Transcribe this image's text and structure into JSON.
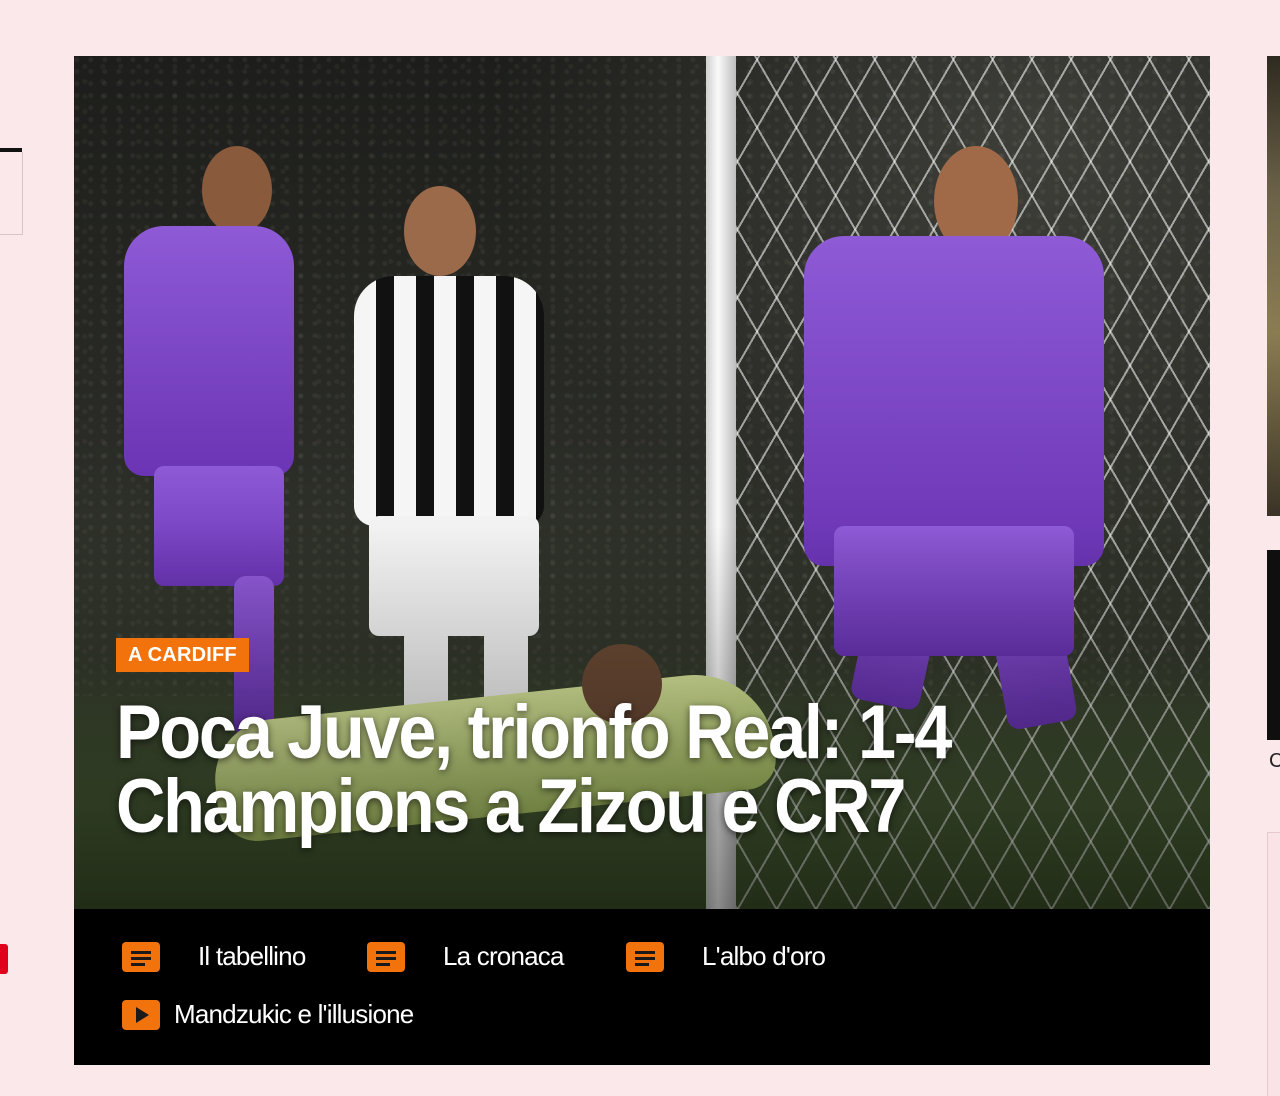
{
  "hero": {
    "kicker": "A CARDIFF",
    "headline_line1": "Poca Juve, trionfo Real: 1-4",
    "headline_line2": "Champions a Zizou e CR7"
  },
  "related_links": [
    {
      "label": "Il tabellino",
      "icon": "article-icon"
    },
    {
      "label": "La cronaca",
      "icon": "article-icon"
    },
    {
      "label": "L'albo d'oro",
      "icon": "article-icon"
    },
    {
      "label": "Mandzukic e l'illusione",
      "icon": "video-play-icon"
    }
  ],
  "right_column": {
    "caption_fragment": "C"
  },
  "colors": {
    "page_background": "#fbe8ea",
    "accent_orange": "#f2720c",
    "link_bar": "#000000",
    "left_badge_red": "#e0001b"
  }
}
